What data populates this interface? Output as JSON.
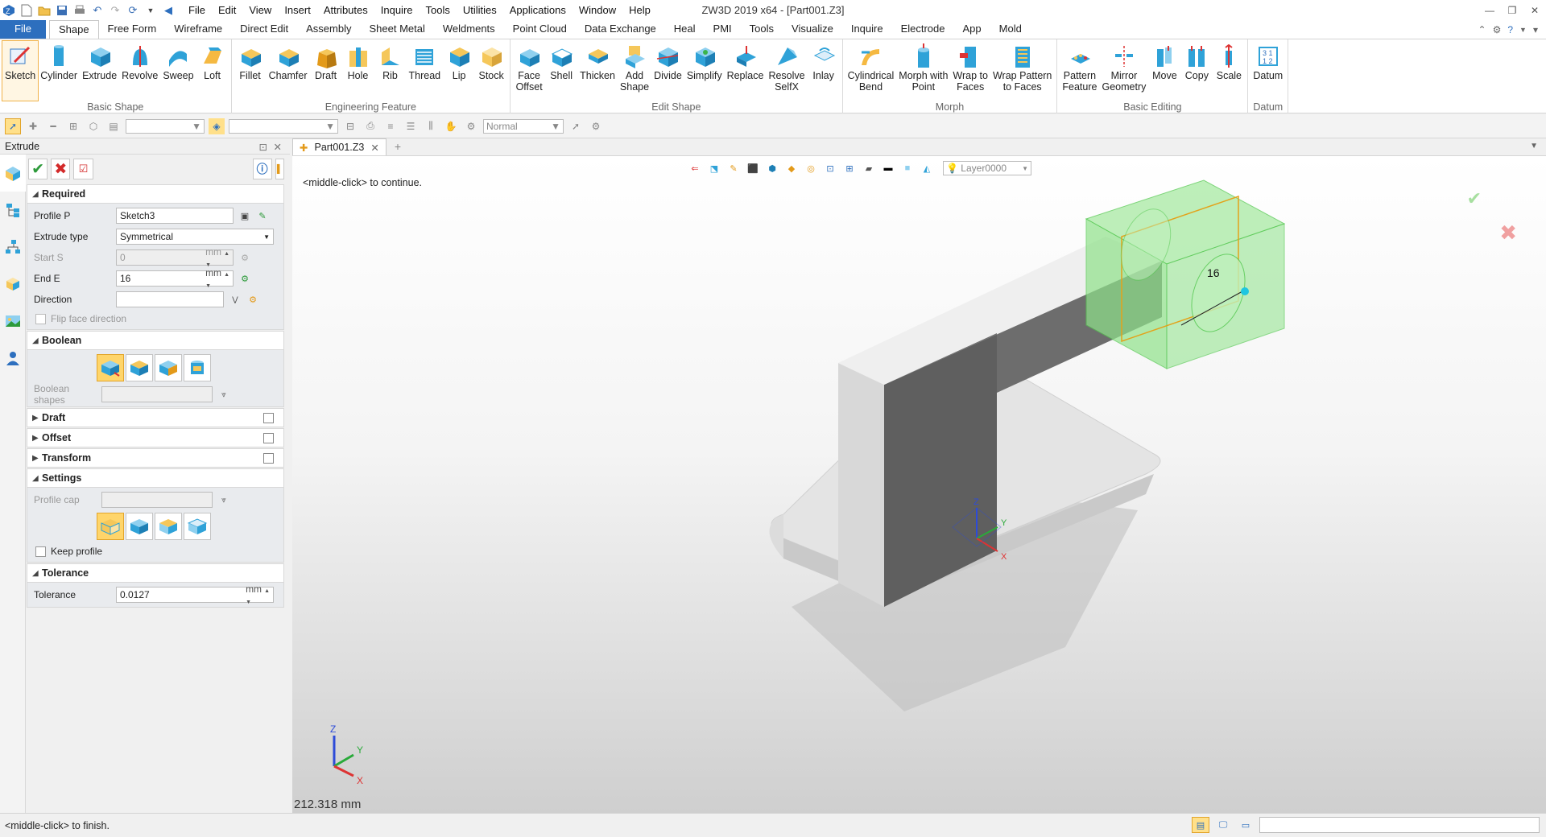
{
  "titlebar": {
    "title": "ZW3D 2019  x64 - [Part001.Z3]",
    "menus": [
      "File",
      "Edit",
      "View",
      "Insert",
      "Attributes",
      "Inquire",
      "Tools",
      "Utilities",
      "Applications",
      "Window",
      "Help"
    ]
  },
  "ribbon_tabs": [
    "File",
    "Shape",
    "Free Form",
    "Wireframe",
    "Direct Edit",
    "Assembly",
    "Sheet Metal",
    "Weldments",
    "Point Cloud",
    "Data Exchange",
    "Heal",
    "PMI",
    "Tools",
    "Visualize",
    "Inquire",
    "Electrode",
    "App",
    "Mold"
  ],
  "active_tab": "Shape",
  "ribbon": {
    "groups": [
      {
        "title": "Basic Shape",
        "buttons": [
          "Sketch",
          "Cylinder",
          "Extrude",
          "Revolve",
          "Sweep",
          "Loft"
        ]
      },
      {
        "title": "Engineering Feature",
        "buttons": [
          "Fillet",
          "Chamfer",
          "Draft",
          "Hole",
          "Rib",
          "Thread",
          "Lip",
          "Stock"
        ]
      },
      {
        "title": "Edit Shape",
        "buttons": [
          "Face\nOffset",
          "Shell",
          "Thicken",
          "Add\nShape",
          "Divide",
          "Simplify",
          "Replace",
          "Resolve\nSelfX",
          "Inlay"
        ]
      },
      {
        "title": "Morph",
        "buttons": [
          "Cylindrical\nBend",
          "Morph with\nPoint",
          "Wrap to\nFaces",
          "Wrap Pattern\nto Faces"
        ]
      },
      {
        "title": "Basic Editing",
        "buttons": [
          "Pattern\nFeature",
          "Mirror\nGeometry",
          "Move",
          "Copy",
          "Scale"
        ]
      },
      {
        "title": "Datum",
        "buttons": [
          "Datum"
        ]
      }
    ]
  },
  "toolbar2": {
    "filter_value": "Normal"
  },
  "panel": {
    "title": "Extrude",
    "required": {
      "header": "Required",
      "profile_label": "Profile P",
      "profile_value": "Sketch3",
      "extrude_type_label": "Extrude type",
      "extrude_type_value": "Symmetrical",
      "start_label": "Start S",
      "start_value": "0",
      "start_unit": "mm",
      "end_label": "End E",
      "end_value": "16",
      "end_unit": "mm",
      "direction_label": "Direction",
      "direction_value": "",
      "flip_label": "Flip face direction"
    },
    "boolean": {
      "header": "Boolean",
      "shapes_label": "Boolean shapes"
    },
    "draft_header": "Draft",
    "offset_header": "Offset",
    "transform_header": "Transform",
    "settings": {
      "header": "Settings",
      "profile_cap_label": "Profile cap",
      "keep_profile_label": "Keep profile"
    },
    "tolerance": {
      "header": "Tolerance",
      "label": "Tolerance",
      "value": "0.0127",
      "unit": "mm"
    }
  },
  "doc_tab": "Part001.Z3",
  "viewport": {
    "hint": "<middle-click> to continue.",
    "layer": "Layer0000",
    "dimension_label": "16",
    "measure": "212.318 mm",
    "triad_labels": {
      "x": "X",
      "y": "Y",
      "z": "Z"
    }
  },
  "statusbar": {
    "message": "<middle-click> to finish."
  },
  "colors": {
    "accent": "#2d6fbe",
    "preview_green": "#7ddc7a",
    "preview_orange": "#e3a21a",
    "model_gray": "#c8c8c8"
  }
}
